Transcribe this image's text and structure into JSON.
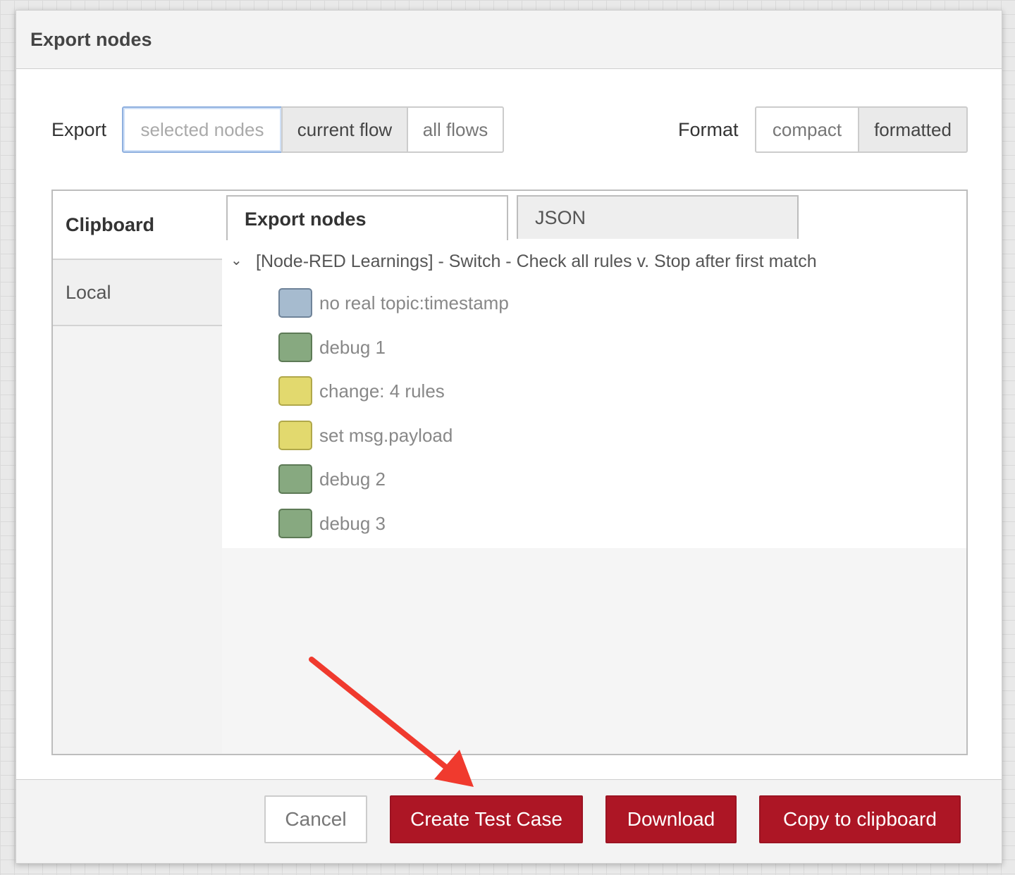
{
  "dialog": {
    "title": "Export nodes"
  },
  "export_scope": {
    "label": "Export",
    "options": [
      "selected nodes",
      "current flow",
      "all flows"
    ],
    "selected": "current flow"
  },
  "format": {
    "label": "Format",
    "options": [
      "compact",
      "formatted"
    ],
    "selected": "formatted"
  },
  "side_tabs": {
    "clipboard": "Clipboard",
    "local": "Local"
  },
  "content_tabs": {
    "export_nodes": "Export nodes",
    "json": "JSON"
  },
  "tree": {
    "flow_name": "[Node-RED Learnings] - Switch - Check all rules v. Stop after first match",
    "nodes": [
      {
        "label": "no real topic:timestamp",
        "type": "inject",
        "color": "#a6bbcf"
      },
      {
        "label": "debug 1",
        "type": "debug",
        "color": "#87a980"
      },
      {
        "label": "change: 4 rules",
        "type": "change",
        "color": "#e2d96e"
      },
      {
        "label": "set msg.payload",
        "type": "change",
        "color": "#e2d96e"
      },
      {
        "label": "debug 2",
        "type": "debug",
        "color": "#87a980"
      },
      {
        "label": "debug 3",
        "type": "debug",
        "color": "#87a980"
      }
    ]
  },
  "footer": {
    "cancel": "Cancel",
    "create_test_case": "Create Test Case",
    "download": "Download",
    "copy": "Copy to clipboard"
  },
  "colors": {
    "primary_button": "#ad1625",
    "annotation_arrow": "#f03a2e"
  }
}
